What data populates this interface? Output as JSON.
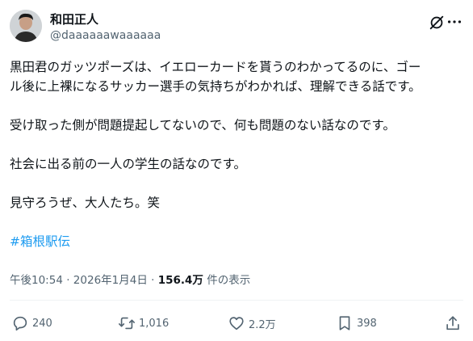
{
  "author": {
    "display_name": "和田正人",
    "handle": "@daaaaaawaaaaaa"
  },
  "body": {
    "lines": [
      "黒田君のガッツポーズは、イエローカードを貰うのわかってるのに、ゴー",
      "ル後に上裸になるサッカー選手の気持ちがわかれば、理解できる話です。",
      "",
      "受け取った側が問題提起してないので、何も問題のない話なのです。",
      "",
      "社会に出る前の一人の学生の話なのです。",
      "",
      "見守ろうぜ、大人たち。笑",
      ""
    ],
    "hashtag": "#箱根駅伝"
  },
  "meta": {
    "time": "午後10:54",
    "separator": "·",
    "date": "2026年1月4日",
    "views_count": "156.4万",
    "views_label": "件の表示"
  },
  "actions": {
    "replies": "240",
    "reposts": "1,016",
    "likes": "2.2万",
    "bookmarks": "398"
  },
  "icons": {
    "grok": "grok-icon",
    "more": "more-icon",
    "reply": "reply-icon",
    "repost": "repost-icon",
    "like": "heart-icon",
    "bookmark": "bookmark-icon",
    "share": "share-icon"
  },
  "colors": {
    "text": "#0f1419",
    "secondary": "#536471",
    "link": "#1d9bf0"
  }
}
